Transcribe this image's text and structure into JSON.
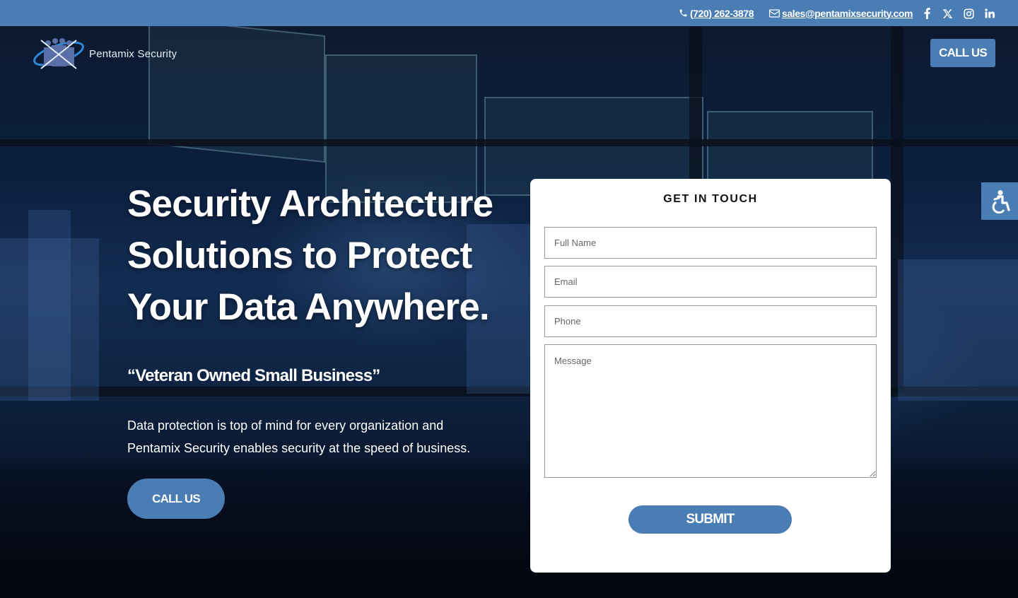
{
  "topbar": {
    "phone": "(720) 262-3878",
    "email": "sales@pentamixsecurity.com",
    "social": [
      "facebook-icon",
      "x-icon",
      "instagram-icon",
      "linkedin-icon"
    ]
  },
  "header": {
    "logo_text": "Pentamix Security",
    "call_label": "CALL US"
  },
  "hero": {
    "headline": "Security Architecture Solutions to Protect Your Data Anywhere.",
    "tagline": "“Veteran Owned Small Business”",
    "description": "Data protection is top of mind for every organization and Pentamix Security enables security at the speed of business.",
    "cta_label": "CALL US"
  },
  "form": {
    "title": "GET IN TOUCH",
    "name_placeholder": "Full Name",
    "email_placeholder": "Email",
    "phone_placeholder": "Phone",
    "message_placeholder": "Message",
    "submit_label": "SUBMIT"
  },
  "colors": {
    "brand_blue": "#4a7db4",
    "topbar": "#4a7db4",
    "card": "#ffffff"
  }
}
